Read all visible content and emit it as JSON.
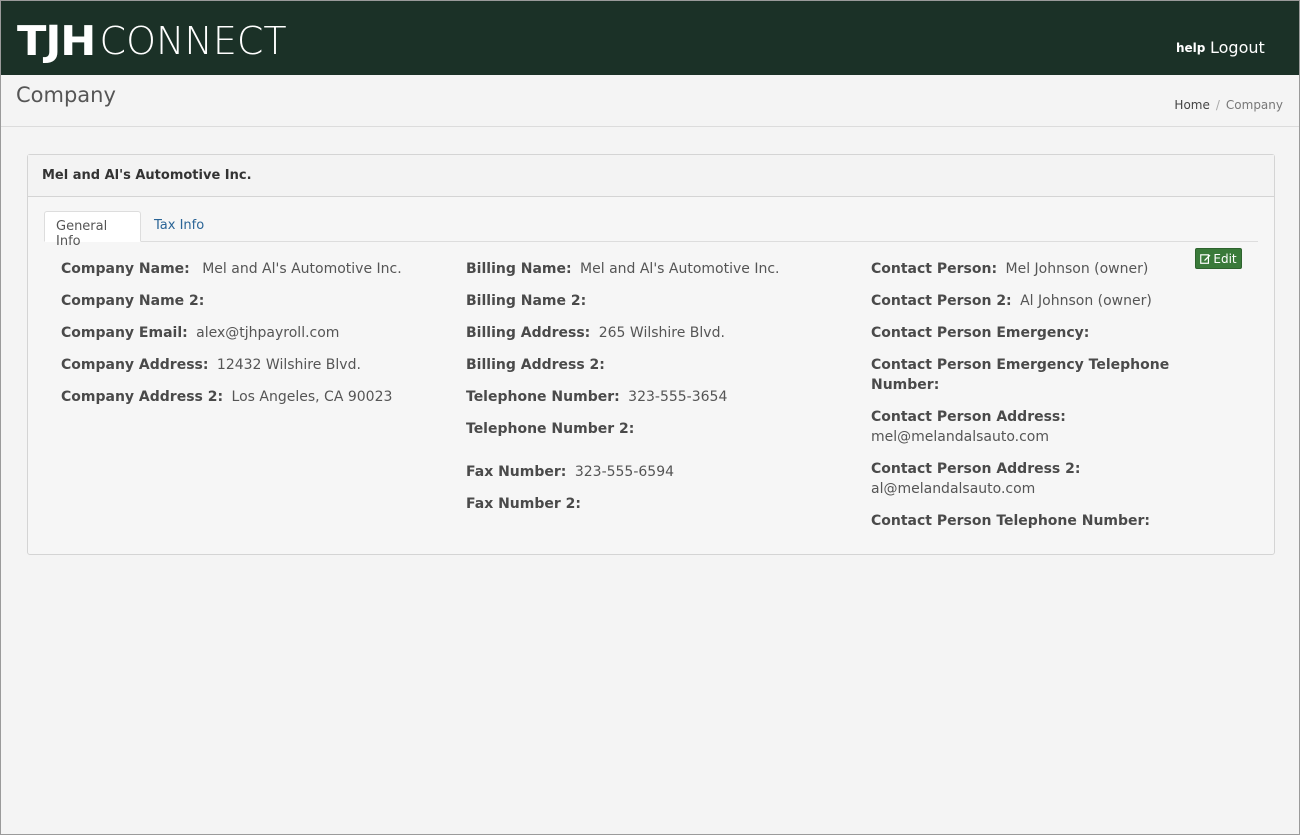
{
  "brand": {
    "bold": "TJH",
    "thin": "CONNECT"
  },
  "nav": {
    "help": "help",
    "logout": "Logout"
  },
  "page": {
    "title": "Company"
  },
  "breadcrumb": {
    "home": "Home",
    "separator": "/",
    "current": "Company"
  },
  "panel": {
    "heading": "Mel and Al's Automotive Inc."
  },
  "tabs": [
    {
      "label": "General Info",
      "active": true
    },
    {
      "label": "Tax Info",
      "active": false
    }
  ],
  "edit_button": {
    "label": "Edit",
    "icon": "edit-icon"
  },
  "general": {
    "company_name": {
      "label": "Company Name:",
      "value": "Mel and Al's Automotive Inc."
    },
    "company_name_2": {
      "label": "Company Name 2:",
      "value": ""
    },
    "company_email": {
      "label": "Company Email:",
      "value": "alex@tjhpayroll.com"
    },
    "company_address": {
      "label": "Company Address:",
      "value": "12432 Wilshire Blvd."
    },
    "company_address_2": {
      "label": "Company Address 2:",
      "value": "Los Angeles, CA 90023"
    },
    "billing_name": {
      "label": "Billing Name:",
      "value": "Mel and Al's Automotive Inc."
    },
    "billing_name_2": {
      "label": "Billing Name 2:",
      "value": ""
    },
    "billing_address": {
      "label": "Billing Address:",
      "value": "265 Wilshire Blvd."
    },
    "billing_address_2": {
      "label": "Billing Address 2:",
      "value": ""
    },
    "telephone_number": {
      "label": "Telephone Number:",
      "value": "323-555-3654"
    },
    "telephone_number_2": {
      "label": "Telephone Number 2:",
      "value": ""
    },
    "fax_number": {
      "label": "Fax Number:",
      "value": "323-555-6594"
    },
    "fax_number_2": {
      "label": "Fax Number 2:",
      "value": ""
    },
    "contact_person": {
      "label": "Contact Person:",
      "value": "Mel Johnson (owner)"
    },
    "contact_person_2": {
      "label": "Contact Person 2:",
      "value": "Al Johnson (owner)"
    },
    "contact_emergency": {
      "label": "Contact Person Emergency:",
      "value": ""
    },
    "contact_emergency_phone": {
      "label": "Contact Person Emergency Telephone Number:",
      "value": ""
    },
    "contact_address": {
      "label": "Contact Person Address:",
      "value": "mel@melandalsauto.com"
    },
    "contact_address_2": {
      "label": "Contact Person Address 2:",
      "value": "al@melandalsauto.com"
    },
    "contact_phone": {
      "label": "Contact Person Telephone Number:",
      "value": ""
    }
  },
  "colors": {
    "navbar": "#1b3127",
    "edit_button": "#3a7a3a",
    "link": "#2a6496"
  }
}
